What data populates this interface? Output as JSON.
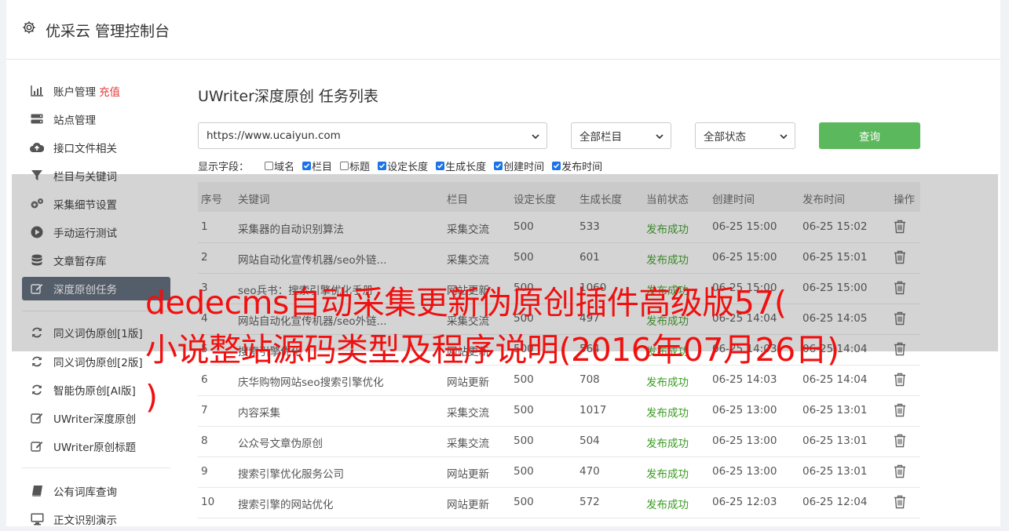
{
  "header": {
    "title": "优采云 管理控制台"
  },
  "sidebar": {
    "items": [
      {
        "label": "账户管理",
        "extra": "充值",
        "icon": "bar-chart-icon"
      },
      {
        "label": "站点管理",
        "icon": "server-icon"
      },
      {
        "label": "接口文件相关",
        "icon": "cloud-upload-icon"
      },
      {
        "label": "栏目与关键词",
        "icon": "filter-icon"
      },
      {
        "label": "采集细节设置",
        "icon": "cogs-icon"
      },
      {
        "label": "手动运行测试",
        "icon": "play-circle-icon"
      },
      {
        "label": "文章暂存库",
        "icon": "database-icon"
      },
      {
        "label": "深度原创任务",
        "icon": "edit-icon",
        "active": true
      },
      {
        "label": "同义词伪原创[1版]",
        "icon": "refresh-icon"
      },
      {
        "label": "同义词伪原创[2版]",
        "icon": "refresh-icon"
      },
      {
        "label": "智能伪原创[AI版]",
        "icon": "refresh-icon"
      },
      {
        "label": "UWriter深度原创",
        "icon": "edit-icon"
      },
      {
        "label": "UWriter原创标题",
        "icon": "edit-icon"
      },
      {
        "label": "公有词库查询",
        "icon": "book-icon"
      },
      {
        "label": "正文识别演示",
        "icon": "monitor-icon"
      }
    ]
  },
  "main": {
    "title": "UWriter深度原创 任务列表",
    "filters": {
      "site": "https://www.ucaiyun.com",
      "column": "全部栏目",
      "status": "全部状态",
      "query_label": "查询"
    },
    "fields_label": "显示字段：",
    "fields": [
      {
        "label": "域名",
        "checked": false
      },
      {
        "label": "栏目",
        "checked": true
      },
      {
        "label": "标题",
        "checked": false
      },
      {
        "label": "设定长度",
        "checked": true
      },
      {
        "label": "生成长度",
        "checked": true
      },
      {
        "label": "创建时间",
        "checked": true
      },
      {
        "label": "发布时间",
        "checked": true
      }
    ],
    "table": {
      "headers": [
        "序号",
        "关键词",
        "栏目",
        "设定长度",
        "生成长度",
        "当前状态",
        "创建时间",
        "发布时间",
        "操作"
      ],
      "rows": [
        [
          "1",
          "采集器的自动识别算法",
          "采集交流",
          "500",
          "533",
          "发布成功",
          "06-25 15:00",
          "06-25 15:02"
        ],
        [
          "2",
          "网站自动化宣传机器/seo外链...",
          "采集交流",
          "500",
          "601",
          "发布成功",
          "06-25 15:00",
          "06-25 15:01"
        ],
        [
          "3",
          "seo兵书：搜索引擎优化手册",
          "网站更新",
          "500",
          "1060",
          "发布成功",
          "06-25 15:00",
          "06-25 15:00"
        ],
        [
          "4",
          "网站自动化宣传机器/seo外链...",
          "采集交流",
          "500",
          "497",
          "发布成功",
          "06-25 14:04",
          "06-25 14:05"
        ],
        [
          "5",
          "搜索引擎优化",
          "网站更新",
          "500",
          "564",
          "发布成功",
          "06-25 14:03",
          "06-25 14:04"
        ],
        [
          "6",
          "庆华购物网站seo搜索引擎优化",
          "网站更新",
          "500",
          "708",
          "发布成功",
          "06-25 14:03",
          "06-25 14:04"
        ],
        [
          "7",
          "内容采集",
          "采集交流",
          "500",
          "1017",
          "发布成功",
          "06-25 13:00",
          "06-25 13:01"
        ],
        [
          "8",
          "公众号文章伪原创",
          "采集交流",
          "500",
          "504",
          "发布成功",
          "06-25 13:00",
          "06-25 13:01"
        ],
        [
          "9",
          "搜索引擎优化服务公司",
          "网站更新",
          "500",
          "470",
          "发布成功",
          "06-25 13:00",
          "06-25 13:01"
        ],
        [
          "10",
          "搜索引擎的网站优化",
          "网站更新",
          "500",
          "572",
          "发布成功",
          "06-25 12:03",
          "06-25 12:04"
        ]
      ]
    }
  },
  "watermark": {
    "lines": [
      "dedecms自动采集更新伪原创插件高级版57(",
      "小说整站源码类型及程序说明(2016年07月26日)",
      ")"
    ]
  },
  "colors": {
    "accent": "#5cb85c",
    "active_nav": "#5b6778",
    "success": "#3a9d23",
    "danger": "#e4393c",
    "watermark": "#f01010"
  }
}
